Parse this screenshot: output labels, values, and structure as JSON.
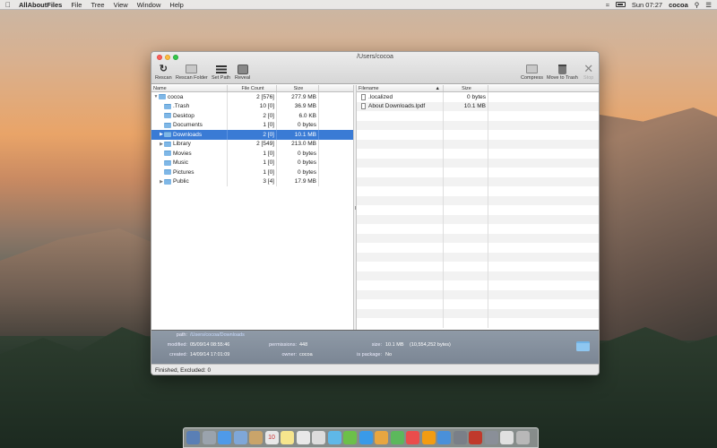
{
  "menubar": {
    "app_name": "AllAboutFiles",
    "menus": [
      "File",
      "Tree",
      "View",
      "Window",
      "Help"
    ],
    "clock": "Sun 07:27",
    "user": "cocoa"
  },
  "window": {
    "title": "/Users/cocoa",
    "toolbar_left": [
      {
        "label": "Rescan",
        "icon": "rescan-icon"
      },
      {
        "label": "Rescan Folder",
        "icon": "rescan-folder-icon"
      },
      {
        "label": "Set Path",
        "icon": "set-path-icon"
      },
      {
        "label": "Reveal",
        "icon": "reveal-icon"
      }
    ],
    "toolbar_right": [
      {
        "label": "Compress",
        "icon": "compress-icon"
      },
      {
        "label": "Move to Trash",
        "icon": "trash-icon"
      },
      {
        "label": "Stop",
        "icon": "stop-icon"
      }
    ]
  },
  "tree": {
    "columns": {
      "name": "Name",
      "count": "File Count",
      "size": "Size"
    },
    "rows": [
      {
        "name": "cocoa",
        "count": "2 [576]",
        "size": "277.9 MB",
        "level": 0,
        "expanded": true
      },
      {
        "name": ".Trash",
        "count": "10 [0]",
        "size": "36.9 MB",
        "level": 1
      },
      {
        "name": "Desktop",
        "count": "2 [0]",
        "size": "6.0 KB",
        "level": 1
      },
      {
        "name": "Documents",
        "count": "1 [0]",
        "size": "0 bytes",
        "level": 1
      },
      {
        "name": "Downloads",
        "count": "2 [0]",
        "size": "10.1 MB",
        "level": 1,
        "selected": true
      },
      {
        "name": "Library",
        "count": "2 [549]",
        "size": "213.0 MB",
        "level": 1
      },
      {
        "name": "Movies",
        "count": "1 [0]",
        "size": "0 bytes",
        "level": 1
      },
      {
        "name": "Music",
        "count": "1 [0]",
        "size": "0 bytes",
        "level": 1
      },
      {
        "name": "Pictures",
        "count": "1 [0]",
        "size": "0 bytes",
        "level": 1
      },
      {
        "name": "Public",
        "count": "3 [4]",
        "size": "17.9 MB",
        "level": 1
      }
    ]
  },
  "files": {
    "columns": {
      "filename": "Filename",
      "size": "Size"
    },
    "rows": [
      {
        "name": ".localized",
        "size": "0 bytes"
      },
      {
        "name": "About Downloads.lpdf",
        "size": "10.1 MB"
      }
    ]
  },
  "info": {
    "path_label": "path:",
    "path_value": "/Users/cocoa/Downloads",
    "modified_label": "modified:",
    "modified_value": "05/09/14 08:55:46",
    "created_label": "created:",
    "created_value": "14/09/14 17:01:09",
    "permissions_label": "permissions:",
    "permissions_value": "448",
    "owner_label": "owner:",
    "owner_value": "cocoa",
    "size_label": "size:",
    "size_value": "10.1 MB",
    "size_bytes": "(10,554,252 bytes)",
    "package_label": "is package:",
    "package_value": "No"
  },
  "status": "Finished, Excluded: 0",
  "dock": {
    "calendar_day": "10",
    "colors": [
      "#5a7fb5",
      "#9aa3ad",
      "#4f9ae8",
      "#7fa7d8",
      "#c9a46a",
      "#e8e8e8",
      "#f6e58d",
      "#e8e8e8",
      "#dcdcdc",
      "#5fb8e8",
      "#6cc04a",
      "#3a9ae8",
      "#e8a640",
      "#5cb85c",
      "#ea4c4c",
      "#f39c12",
      "#4a90d9",
      "#7a7f88",
      "#c0392b",
      "#8a8f98",
      "#e0e0e0",
      "#b8b8b8"
    ]
  }
}
